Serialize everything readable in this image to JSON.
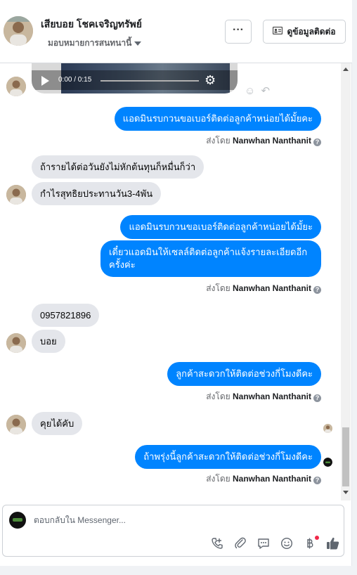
{
  "header": {
    "name": "เสียบอย โชคเจริญทรัพย์",
    "subtitle": "มอบหมายการสนทนานี้",
    "more_label": "···",
    "info_label": "ดูข้อมูลติดต่อ"
  },
  "video": {
    "time": "0:00 / 0:15"
  },
  "messages": {
    "out1": "แอดมินรบกวนขอเบอร์ติดต่อลูกค้าหน่อยได้มั้ยคะ",
    "in1": "ถ้ารายได้ต่อวันยังไม่หักต้นทุนก็หมื่นก็ว่า",
    "in2": "กำไรสุทธิยประทานวัน3-4พัน",
    "out2": "แอดมินรบกวนขอเบอร์ติดต่อลูกค้าหน่อยได้มั้ยะ",
    "out3_line1": "เดี๋ยวแอดมินให้เซลล์ติดต่อลูกค้าแจ้งรายละเอียดอีก",
    "out3_line2": "ครั้งค่ะ",
    "in3": "0957821896",
    "in4": "บอย",
    "out4": "ลูกค้าสะดวกให้ติดต่อช่วงกี่โมงดีคะ",
    "in5": "คุยได้คับ",
    "out5": "ถ้าพรุ่งนี้ลูกค้าสะดวกให้ติดต่อช่วงกี่โมงดีคะ"
  },
  "sent_by": {
    "prefix": "ส่งโดย",
    "agent": "Nanwhan Nanthanit"
  },
  "composer": {
    "placeholder": "ตอบกลับใน Messenger..."
  },
  "colors": {
    "outgoing_bubble": "#0084ff",
    "incoming_bubble": "#e4e6eb",
    "badge": "#f02849"
  }
}
